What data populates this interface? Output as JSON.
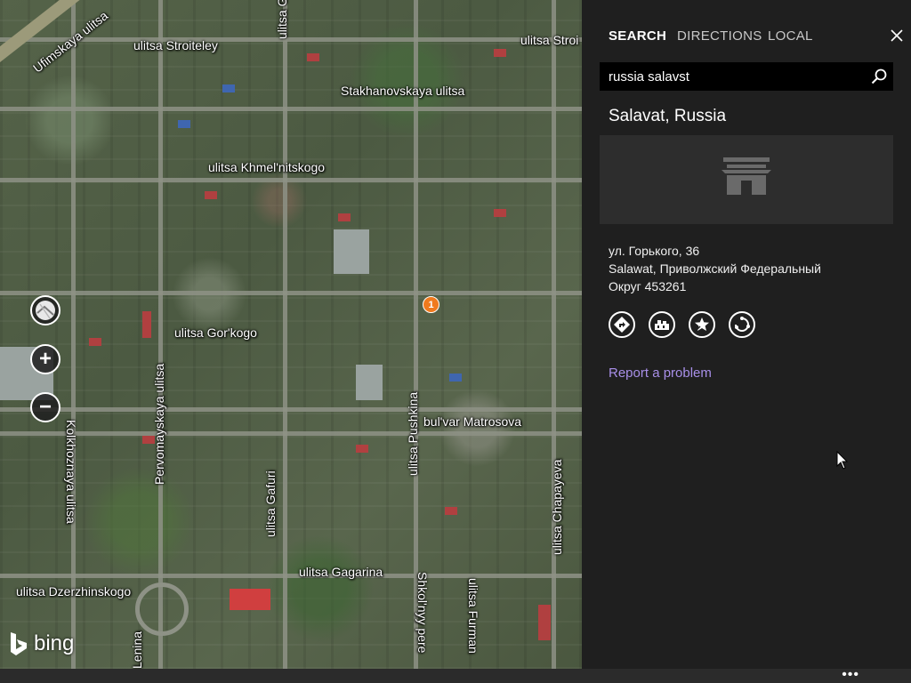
{
  "map": {
    "streets": {
      "ufimskaya": "Ufimskaya ulitsa",
      "stroiteley": "ulitsa Stroiteley",
      "stroiteley_right": "ulitsa Stroi",
      "stakhanovskaya": "Stakhanovskaya ulitsa",
      "khmelnitskogo": "ulitsa Khmel'nitskogo",
      "gafuri_top": "ulitsa Gafuri",
      "gorkogo": "ulitsa Gor'kogo",
      "pervomayskaya": "Pervomayskaya ulitsa",
      "pushkina": "ulitsa Pushkina",
      "matrosova": "bul'var Matrosova",
      "kolkhoznaya": "Kolkhoznaya ulitsa",
      "gafuri_bottom": "ulitsa Gafuri",
      "chapayeva": "ulitsa Chapayeva",
      "gagarina": "ulitsa Gagarina",
      "dzerzhinskogo": "ulitsa Dzerzhinskogo",
      "shkolnyy": "Shkol'nyy pere",
      "furmanova": "ulitsa Furman",
      "lenina": "Lenina"
    },
    "pin_label": "1",
    "controls": {
      "map_style_icon": "map-style-icon",
      "zoom_in_label": "+",
      "zoom_out_label": "−"
    },
    "logo_text": "bing"
  },
  "panel": {
    "tabs": [
      {
        "label": "SEARCH",
        "active": true
      },
      {
        "label": "DIRECTIONS",
        "active": false
      },
      {
        "label": "LOCAL",
        "active": false
      }
    ],
    "search": {
      "value": "russia salavst",
      "icon": "search-icon"
    },
    "result": {
      "title": "Salavat, Russia",
      "image_icon": "building-icon",
      "address": [
        "ул. Горького, 36",
        "Salawat, Приволжский Федеральный",
        "Округ 453261"
      ],
      "actions": [
        {
          "icon": "directions-icon"
        },
        {
          "icon": "nearby-icon"
        },
        {
          "icon": "favorite-icon"
        },
        {
          "icon": "share-icon"
        }
      ],
      "report_link": "Report a problem"
    }
  },
  "appbar": {
    "more_label": "•••"
  },
  "colors": {
    "panel_bg": "#1f1f1f",
    "accent_link": "#a88fe8",
    "pin": "#f07a1e",
    "search_bg": "#000000"
  }
}
